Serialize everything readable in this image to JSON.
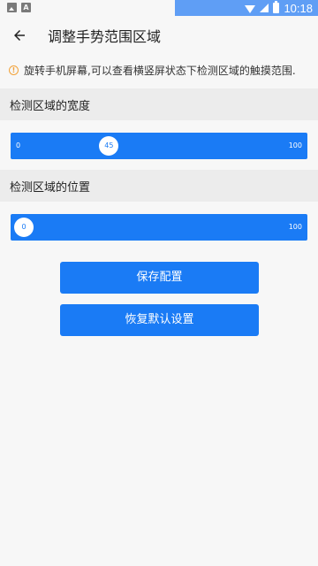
{
  "status_bar": {
    "time": "10:18",
    "icons": [
      "image-notification-icon",
      "a-notification-icon",
      "wifi-icon",
      "signal-icon",
      "battery-icon"
    ],
    "accent_color": "#5f9ef5"
  },
  "header": {
    "title": "调整手势范围区域",
    "back_icon": "back-arrow-icon"
  },
  "info": {
    "icon": "warning-info-icon",
    "text": "旋转手机屏幕,可以查看横竖屏状态下检测区域的触摸范围.",
    "icon_color": "#f2a23a"
  },
  "width_section": {
    "label": "检测区域的宽度",
    "slider": {
      "min": "0",
      "max": "100",
      "value": 45,
      "value_label": "45"
    }
  },
  "position_section": {
    "label": "检测区域的位置",
    "slider": {
      "min": "0",
      "max": "100",
      "value": 0,
      "value_label": "0"
    }
  },
  "buttons": {
    "save_label": "保存配置",
    "reset_label": "恢复默认设置"
  },
  "colors": {
    "primary": "#1a7bf5",
    "section_bg": "#ececec",
    "page_bg": "#f7f7f7"
  }
}
